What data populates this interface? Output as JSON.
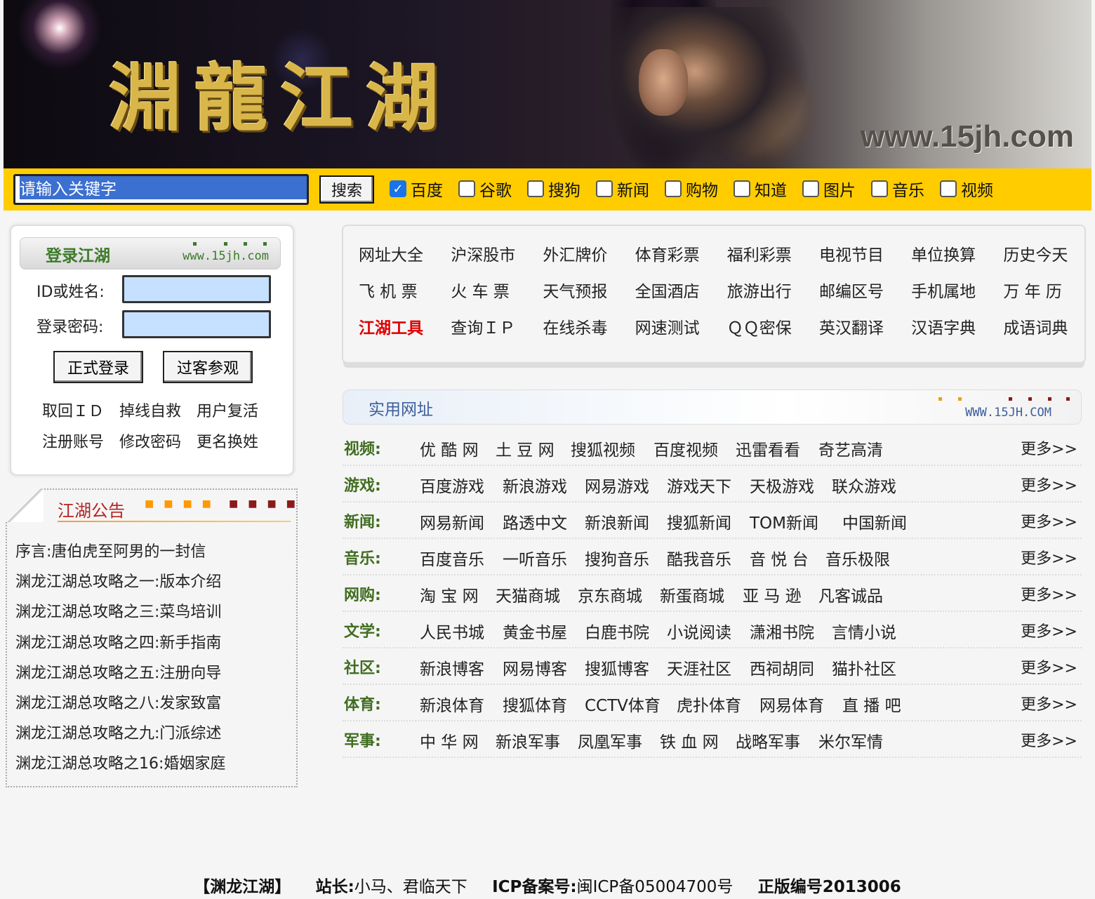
{
  "banner": {
    "logo_text": "淵龍江湖",
    "url_text": "www.15jh.com"
  },
  "search": {
    "placeholder": "请输入关键字",
    "button_label": "搜索",
    "engines": [
      {
        "label": "百度",
        "checked": true
      },
      {
        "label": "谷歌",
        "checked": false
      },
      {
        "label": "搜狗",
        "checked": false
      },
      {
        "label": "新闻",
        "checked": false
      },
      {
        "label": "购物",
        "checked": false
      },
      {
        "label": "知道",
        "checked": false
      },
      {
        "label": "图片",
        "checked": false
      },
      {
        "label": "音乐",
        "checked": false
      },
      {
        "label": "视频",
        "checked": false
      }
    ]
  },
  "login": {
    "title": "登录江湖",
    "site": "www.15jh.com",
    "id_label": "ID或姓名:",
    "pwd_label": "登录密码:",
    "login_button": "正式登录",
    "guest_button": "过客参观",
    "links": [
      "取回ＩＤ",
      "掉线自救",
      "用户复活",
      "注册账号",
      "修改密码",
      "更名换姓"
    ]
  },
  "notice": {
    "title": "江湖公告",
    "items": [
      "序言:唐伯虎至阿男的一封信",
      "渊龙江湖总攻略之一:版本介绍",
      "渊龙江湖总攻略之三:菜鸟培训",
      "渊龙江湖总攻略之四:新手指南",
      "渊龙江湖总攻略之五:注册向导",
      "渊龙江湖总攻略之八:发家致富",
      "渊龙江湖总攻略之九:门派综述",
      "渊龙江湖总攻略之16:婚姻家庭"
    ]
  },
  "tools": {
    "items": [
      "网址大全",
      "沪深股市",
      "外汇牌价",
      "体育彩票",
      "福利彩票",
      "电视节目",
      "单位换算",
      "历史今天",
      "飞 机 票",
      "火 车 票",
      "天气预报",
      "全国酒店",
      "旅游出行",
      "邮编区号",
      "手机属地",
      "万 年 历",
      "江湖工具",
      "查询ＩＰ",
      "在线杀毒",
      "网速测试",
      "ＱＱ密保",
      "英汉翻译",
      "汉语字典",
      "成语词典"
    ]
  },
  "useful": {
    "title": "实用网址",
    "site": "WWW.15JH.COM",
    "more_label": "更多>>",
    "rows": [
      {
        "cat": "视频:",
        "items": [
          "优 酷 网",
          "土 豆 网",
          "搜狐视频",
          "百度视频",
          "迅雷看看",
          "奇艺高清"
        ]
      },
      {
        "cat": "游戏:",
        "items": [
          "百度游戏",
          "新浪游戏",
          "网易游戏",
          "游戏天下",
          "天极游戏",
          "联众游戏"
        ]
      },
      {
        "cat": "新闻:",
        "items": [
          "网易新闻",
          "路透中文",
          "新浪新闻",
          "搜狐新闻",
          "TOM新闻",
          "中国新闻"
        ]
      },
      {
        "cat": "音乐:",
        "items": [
          "百度音乐",
          "一听音乐",
          "搜狗音乐",
          "酷我音乐",
          "音 悦 台",
          "音乐极限"
        ]
      },
      {
        "cat": "网购:",
        "items": [
          "淘 宝 网",
          "天猫商城",
          "京东商城",
          "新蛋商城",
          "亚 马 逊",
          "凡客诚品"
        ]
      },
      {
        "cat": "文学:",
        "items": [
          "人民书城",
          "黄金书屋",
          "白鹿书院",
          "小说阅读",
          "潇湘书院",
          "言情小说"
        ]
      },
      {
        "cat": "社区:",
        "items": [
          "新浪博客",
          "网易博客",
          "搜狐博客",
          "天涯社区",
          "西祠胡同",
          "猫扑社区"
        ]
      },
      {
        "cat": "体育:",
        "items": [
          "新浪体育",
          "搜狐体育",
          "CCTV体育",
          "虎扑体育",
          "网易体育",
          "直 播 吧"
        ]
      },
      {
        "cat": "军事:",
        "items": [
          "中 华 网",
          "新浪军事",
          "凤凰军事",
          "铁 血 网",
          "战略军事",
          "米尔军情"
        ]
      }
    ]
  },
  "footer": {
    "site": "【渊龙江湖】",
    "admin_label": "站长:",
    "admin_value": "小马、君临天下",
    "icp_label": "ICP备案号:",
    "icp_value": "闽ICP备05004700号",
    "edition": "正版编号2013006"
  }
}
